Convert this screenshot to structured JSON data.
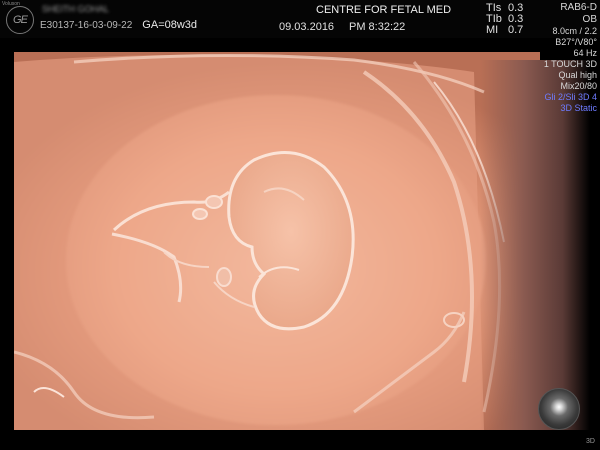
{
  "header": {
    "logo_text": "GE",
    "logo_sub": "Voluson",
    "patient_name": "SHEITH GOHAL",
    "exam_id": "E30137-16-03-09-22",
    "ga": "GA=08w3d",
    "institution": "CENTRE FOR FETAL MED",
    "date": "09.03.2016",
    "time": "PM 8:32:22"
  },
  "indices": [
    {
      "label": "TIs",
      "value": "0.3"
    },
    {
      "label": "TIb",
      "value": "0.3"
    },
    {
      "label": "MI",
      "value": "0.7"
    }
  ],
  "settings": {
    "probe": "RAB6-D",
    "app": "OB",
    "depth": "8.0cm / 2.2",
    "angles": "B27°/V80°",
    "frequency": "64 Hz",
    "mode": "1 TOUCH 3D",
    "quality": "Qual high",
    "mix": "Mix20/80",
    "render": "Gli 2/Sli 3D 4",
    "static": "3D Static"
  },
  "colors": {
    "accent_blue": "#6e7bff",
    "tissue": "#eba487"
  },
  "control": {
    "orb_icon": "trackball-icon"
  },
  "footer": {
    "corner": "3D"
  }
}
